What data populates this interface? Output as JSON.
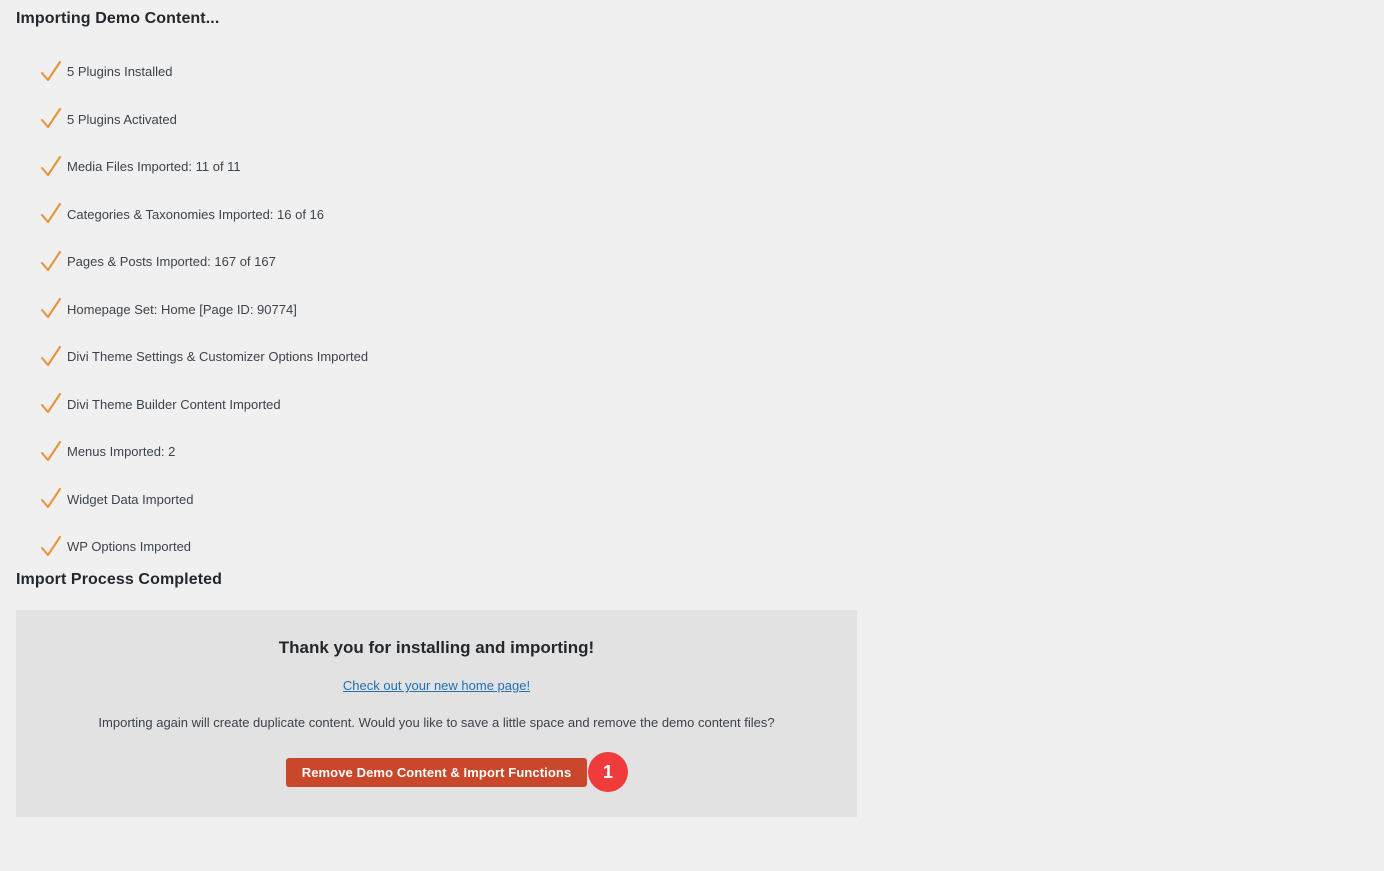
{
  "page": {
    "background_color": "#f0f0f1",
    "import_title": "Importing Demo Content...",
    "completed_title": "Import Process Completed"
  },
  "progress": {
    "check_icon": "orange-check-icon",
    "check_color": "#e8943a",
    "items": [
      {
        "label": "5 Plugins Installed"
      },
      {
        "label": "5 Plugins Activated"
      },
      {
        "label": "Media Files Imported: 11 of 11"
      },
      {
        "label": "Categories & Taxonomies Imported: 16 of 16"
      },
      {
        "label": "Pages & Posts Imported: 167 of 167"
      },
      {
        "label": "Homepage Set: Home [Page ID: 90774]"
      },
      {
        "label": "Divi Theme Settings & Customizer Options Imported"
      },
      {
        "label": "Divi Theme Builder Content Imported"
      },
      {
        "label": "Menus Imported: 2"
      },
      {
        "label": "Widget Data Imported"
      },
      {
        "label": "WP Options Imported"
      }
    ]
  },
  "complete_panel": {
    "background_color": "#e2e2e2",
    "heading": "Thank you for installing and importing!",
    "link_text": "Check out your new home page!",
    "link_color": "#2271b1",
    "note": "Importing again will create duplicate content. Would you like to save a little space and remove the demo content files?",
    "remove_button_label": "Remove Demo Content & Import Functions",
    "remove_button_color": "#c9472a",
    "step_badge_number": "1",
    "step_badge_color": "#ef3b3b"
  }
}
